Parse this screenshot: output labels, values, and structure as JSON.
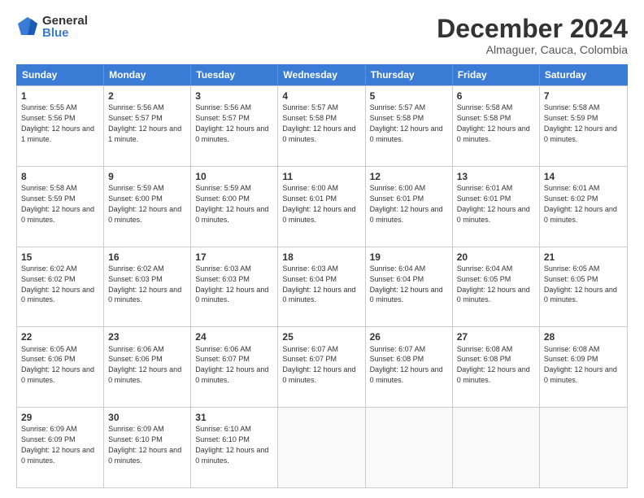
{
  "logo": {
    "general": "General",
    "blue": "Blue"
  },
  "title": "December 2024",
  "subtitle": "Almaguer, Cauca, Colombia",
  "days": [
    "Sunday",
    "Monday",
    "Tuesday",
    "Wednesday",
    "Thursday",
    "Friday",
    "Saturday"
  ],
  "weeks": [
    [
      {
        "day": "1",
        "sunrise": "5:55 AM",
        "sunset": "5:56 PM",
        "daylight": "12 hours and 1 minute."
      },
      {
        "day": "2",
        "sunrise": "5:56 AM",
        "sunset": "5:57 PM",
        "daylight": "12 hours and 1 minute."
      },
      {
        "day": "3",
        "sunrise": "5:56 AM",
        "sunset": "5:57 PM",
        "daylight": "12 hours and 0 minutes."
      },
      {
        "day": "4",
        "sunrise": "5:57 AM",
        "sunset": "5:58 PM",
        "daylight": "12 hours and 0 minutes."
      },
      {
        "day": "5",
        "sunrise": "5:57 AM",
        "sunset": "5:58 PM",
        "daylight": "12 hours and 0 minutes."
      },
      {
        "day": "6",
        "sunrise": "5:58 AM",
        "sunset": "5:58 PM",
        "daylight": "12 hours and 0 minutes."
      },
      {
        "day": "7",
        "sunrise": "5:58 AM",
        "sunset": "5:59 PM",
        "daylight": "12 hours and 0 minutes."
      }
    ],
    [
      {
        "day": "8",
        "sunrise": "5:58 AM",
        "sunset": "5:59 PM",
        "daylight": "12 hours and 0 minutes."
      },
      {
        "day": "9",
        "sunrise": "5:59 AM",
        "sunset": "6:00 PM",
        "daylight": "12 hours and 0 minutes."
      },
      {
        "day": "10",
        "sunrise": "5:59 AM",
        "sunset": "6:00 PM",
        "daylight": "12 hours and 0 minutes."
      },
      {
        "day": "11",
        "sunrise": "6:00 AM",
        "sunset": "6:01 PM",
        "daylight": "12 hours and 0 minutes."
      },
      {
        "day": "12",
        "sunrise": "6:00 AM",
        "sunset": "6:01 PM",
        "daylight": "12 hours and 0 minutes."
      },
      {
        "day": "13",
        "sunrise": "6:01 AM",
        "sunset": "6:01 PM",
        "daylight": "12 hours and 0 minutes."
      },
      {
        "day": "14",
        "sunrise": "6:01 AM",
        "sunset": "6:02 PM",
        "daylight": "12 hours and 0 minutes."
      }
    ],
    [
      {
        "day": "15",
        "sunrise": "6:02 AM",
        "sunset": "6:02 PM",
        "daylight": "12 hours and 0 minutes."
      },
      {
        "day": "16",
        "sunrise": "6:02 AM",
        "sunset": "6:03 PM",
        "daylight": "12 hours and 0 minutes."
      },
      {
        "day": "17",
        "sunrise": "6:03 AM",
        "sunset": "6:03 PM",
        "daylight": "12 hours and 0 minutes."
      },
      {
        "day": "18",
        "sunrise": "6:03 AM",
        "sunset": "6:04 PM",
        "daylight": "12 hours and 0 minutes."
      },
      {
        "day": "19",
        "sunrise": "6:04 AM",
        "sunset": "6:04 PM",
        "daylight": "12 hours and 0 minutes."
      },
      {
        "day": "20",
        "sunrise": "6:04 AM",
        "sunset": "6:05 PM",
        "daylight": "12 hours and 0 minutes."
      },
      {
        "day": "21",
        "sunrise": "6:05 AM",
        "sunset": "6:05 PM",
        "daylight": "12 hours and 0 minutes."
      }
    ],
    [
      {
        "day": "22",
        "sunrise": "6:05 AM",
        "sunset": "6:06 PM",
        "daylight": "12 hours and 0 minutes."
      },
      {
        "day": "23",
        "sunrise": "6:06 AM",
        "sunset": "6:06 PM",
        "daylight": "12 hours and 0 minutes."
      },
      {
        "day": "24",
        "sunrise": "6:06 AM",
        "sunset": "6:07 PM",
        "daylight": "12 hours and 0 minutes."
      },
      {
        "day": "25",
        "sunrise": "6:07 AM",
        "sunset": "6:07 PM",
        "daylight": "12 hours and 0 minutes."
      },
      {
        "day": "26",
        "sunrise": "6:07 AM",
        "sunset": "6:08 PM",
        "daylight": "12 hours and 0 minutes."
      },
      {
        "day": "27",
        "sunrise": "6:08 AM",
        "sunset": "6:08 PM",
        "daylight": "12 hours and 0 minutes."
      },
      {
        "day": "28",
        "sunrise": "6:08 AM",
        "sunset": "6:09 PM",
        "daylight": "12 hours and 0 minutes."
      }
    ],
    [
      {
        "day": "29",
        "sunrise": "6:09 AM",
        "sunset": "6:09 PM",
        "daylight": "12 hours and 0 minutes."
      },
      {
        "day": "30",
        "sunrise": "6:09 AM",
        "sunset": "6:10 PM",
        "daylight": "12 hours and 0 minutes."
      },
      {
        "day": "31",
        "sunrise": "6:10 AM",
        "sunset": "6:10 PM",
        "daylight": "12 hours and 0 minutes."
      },
      null,
      null,
      null,
      null
    ]
  ]
}
